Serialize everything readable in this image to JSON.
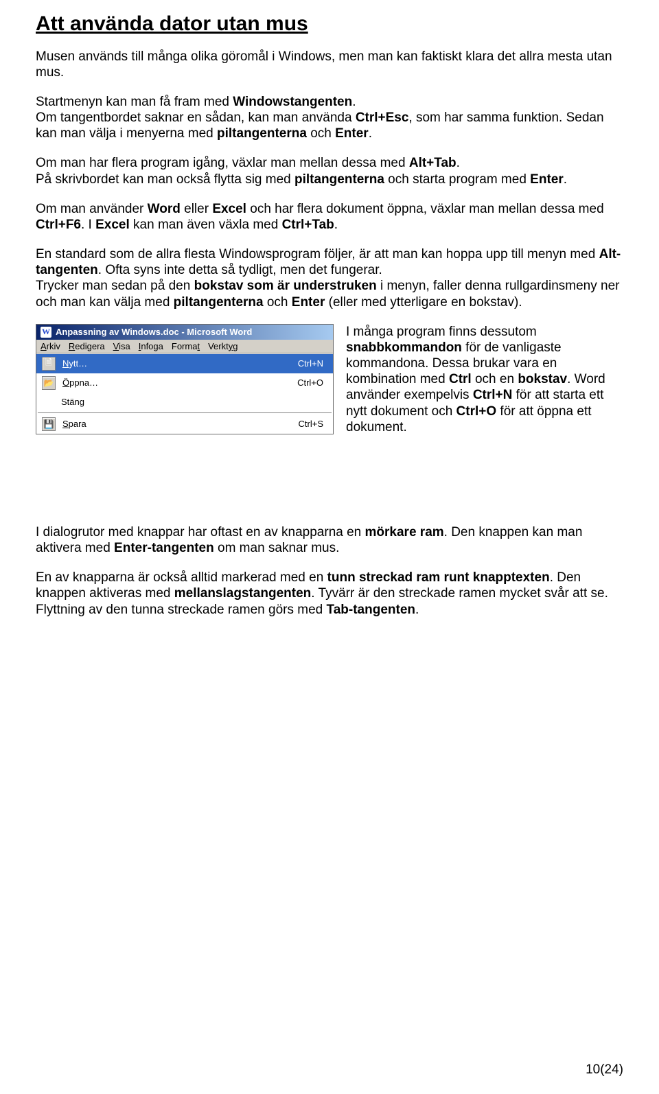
{
  "title": "Att använda dator utan mus",
  "p1": "Musen används till många olika göromål i Windows, men man kan faktiskt klara det allra mesta utan mus.",
  "p2a": "Startmenyn kan man få fram med ",
  "p2b": "Windowstangenten",
  "p2c": ".",
  "p3a": "Om tangentbordet saknar en sådan, kan man använda ",
  "p3b": "Ctrl+Esc",
  "p3c": ", som har samma funktion. Sedan kan man välja i menyerna med ",
  "p3d": "piltangenterna",
  "p3e": " och ",
  "p3f": "Enter",
  "p3g": ".",
  "p4a": "Om man har flera program igång, växlar man mellan dessa med ",
  "p4b": "Alt+Tab",
  "p4c": ".",
  "p5a": "På skrivbordet kan man också flytta sig med ",
  "p5b": "piltangenterna",
  "p5c": " och starta program med ",
  "p5d": "Enter",
  "p5e": ".",
  "p6a": "Om man använder ",
  "p6b": "Word",
  "p6c": " eller ",
  "p6d": "Excel",
  "p6e": " och har flera dokument öppna, växlar man mellan dessa med ",
  "p6f": "Ctrl+F6",
  "p6g": ". I ",
  "p6h": "Excel",
  "p6i": " kan man även växla med ",
  "p6j": "Ctrl+Tab",
  "p6k": ".",
  "p7a": "En standard som de allra flesta Windowsprogram följer, är att man kan hoppa upp till menyn med ",
  "p7b": "Alt-tangenten",
  "p7c": ". Ofta syns inte detta så tydligt, men det fungerar.",
  "p8a": "Trycker man sedan på den ",
  "p8b": "bokstav som är understruken",
  "p8c": " i menyn, faller denna rullgardinsmeny ner och man kan välja med ",
  "p8d": "piltangenterna",
  "p8e": " och ",
  "p8f": "Enter",
  "p8g": " (eller med ytterligare en bokstav).",
  "p9a": "I många program finns dessutom ",
  "p9b": "snabbkommandon",
  "p9c": " för de vanligaste kommandona. Dessa brukar vara en kombination med ",
  "p9d": "Ctrl",
  "p9e": " och en ",
  "p9f": "bokstav",
  "p9g": ". Word använder exempelvis ",
  "p9h": "Ctrl+N",
  "p9i": " för att starta ett nytt dokument och ",
  "p9j": "Ctrl+O",
  "p9k": " för att öppna ett dokument.",
  "p10a": "I dialogrutor med knappar har oftast en av knapparna en ",
  "p10b": "mörkare ram",
  "p10c": ". Den knappen kan man aktivera med ",
  "p10d": "Enter-tangenten",
  "p10e": " om man saknar mus.",
  "p11a": "En av knapparna är också alltid markerad med en ",
  "p11b": "tunn streckad ram runt knapptexten",
  "p11c": ". Den knappen aktiveras med ",
  "p11d": "mellanslagstangenten",
  "p11e": ". Tyvärr är den streckade ramen mycket svår att se. Flyttning av den tunna streckade ramen görs med ",
  "p11f": "Tab-tangenten",
  "p11g": ".",
  "page_num": "10(24)",
  "ss": {
    "title": "Anpassning av Windows.doc - Microsoft Word",
    "menu": {
      "arkiv": "Arkiv",
      "redigera": "Redigera",
      "visa": "Visa",
      "infoga": "Infoga",
      "format": "Format",
      "verktyg": "Verktyg"
    },
    "items": [
      {
        "icon": "new-doc-icon",
        "label": "Nytt…",
        "shortcut": "Ctrl+N",
        "selected": true
      },
      {
        "icon": "open-folder-icon",
        "label": "Öppna…",
        "shortcut": "Ctrl+O",
        "selected": false
      },
      {
        "icon": "",
        "label": "Stäng",
        "shortcut": "",
        "selected": false
      },
      {
        "icon": "save-disk-icon",
        "label": "Spara",
        "shortcut": "Ctrl+S",
        "selected": false
      }
    ]
  }
}
